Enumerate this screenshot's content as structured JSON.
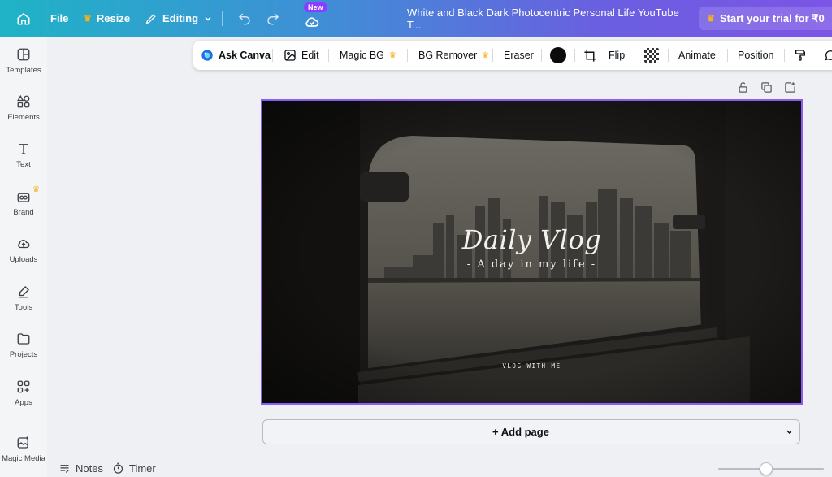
{
  "topbar": {
    "file_label": "File",
    "resize_label": "Resize",
    "editing_label": "Editing",
    "new_badge": "New",
    "doc_title": "White and Black Dark Photocentric Personal Life YouTube T...",
    "trial_label": "Start your trial for ₹0",
    "icons": [
      "home-icon",
      "crown-icon",
      "pencil-icon",
      "chevron-down-icon",
      "undo-icon",
      "redo-icon",
      "cloud-check-icon"
    ]
  },
  "sidebar": {
    "items": [
      {
        "label": "Templates",
        "icon": "templates-icon"
      },
      {
        "label": "Elements",
        "icon": "elements-icon"
      },
      {
        "label": "Text",
        "icon": "text-icon"
      },
      {
        "label": "Brand",
        "icon": "brand-icon"
      },
      {
        "label": "Uploads",
        "icon": "uploads-icon"
      },
      {
        "label": "Tools",
        "icon": "tools-icon"
      },
      {
        "label": "Projects",
        "icon": "projects-icon"
      },
      {
        "label": "Apps",
        "icon": "apps-icon"
      },
      {
        "label": "Magic Media",
        "icon": "magic-media-icon"
      }
    ]
  },
  "toolbar": {
    "ask_canva": "Ask Canva",
    "edit": "Edit",
    "magic_bg": "Magic BG",
    "bg_remover": "BG Remover",
    "eraser": "Eraser",
    "flip": "Flip",
    "animate": "Animate",
    "position": "Position",
    "color_value": "#0b0b0b"
  },
  "canvas": {
    "title": "Daily Vlog",
    "subtitle": "- A day in my life -",
    "footer": "VLOG WITH ME"
  },
  "add_page": {
    "label": "+ Add page"
  },
  "bottom": {
    "notes_label": "Notes",
    "timer_label": "Timer",
    "zoom_level_fraction": 0.45
  },
  "colors": {
    "accent": "#8b5cf6",
    "crown": "#f6b01b",
    "topbar_start": "#1fb3c6",
    "topbar_end": "#7c55e6"
  }
}
